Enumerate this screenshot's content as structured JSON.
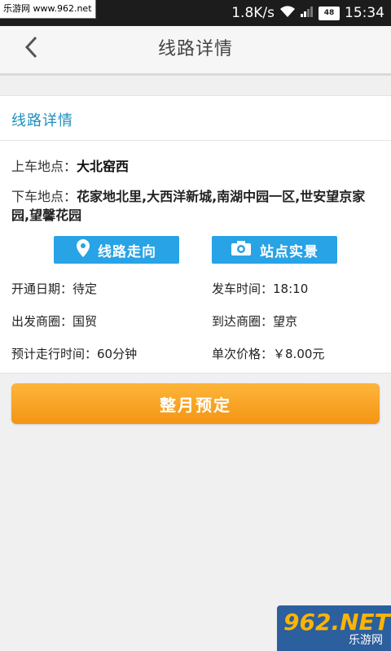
{
  "status_bar": {
    "watermark": "乐游网 www.962.net",
    "speed": "1.8K/s",
    "battery": "48",
    "time": "15:34"
  },
  "header": {
    "title": "线路详情"
  },
  "section": {
    "title": "线路详情"
  },
  "route": {
    "pickup_label": "上车地点：",
    "pickup_value": "大北窑西",
    "dropoff_label": "下车地点：",
    "dropoff_value": "花家地北里,大西洋新城,南湖中园一区,世安望京家园,望馨花园"
  },
  "buttons": {
    "route_direction": "线路走向",
    "station_photos": "站点实景",
    "monthly_booking": "整月预定"
  },
  "details": {
    "open_date_label": "开通日期：",
    "open_date_value": "待定",
    "depart_time_label": "发车时间：",
    "depart_time_value": "18:10",
    "from_area_label": "出发商圈：",
    "from_area_value": "国贸",
    "to_area_label": "到达商圈：",
    "to_area_value": "望京",
    "duration_label": "预计走行时间：",
    "duration_value": "60分钟",
    "price_label": "单次价格：",
    "price_value": "￥8.00元"
  },
  "watermark_logo": {
    "big": "962.NET",
    "small": "乐游网"
  },
  "colors": {
    "accent_blue": "#27a3e6",
    "section_title": "#1f8fbf",
    "orange_button": "#f49514"
  }
}
